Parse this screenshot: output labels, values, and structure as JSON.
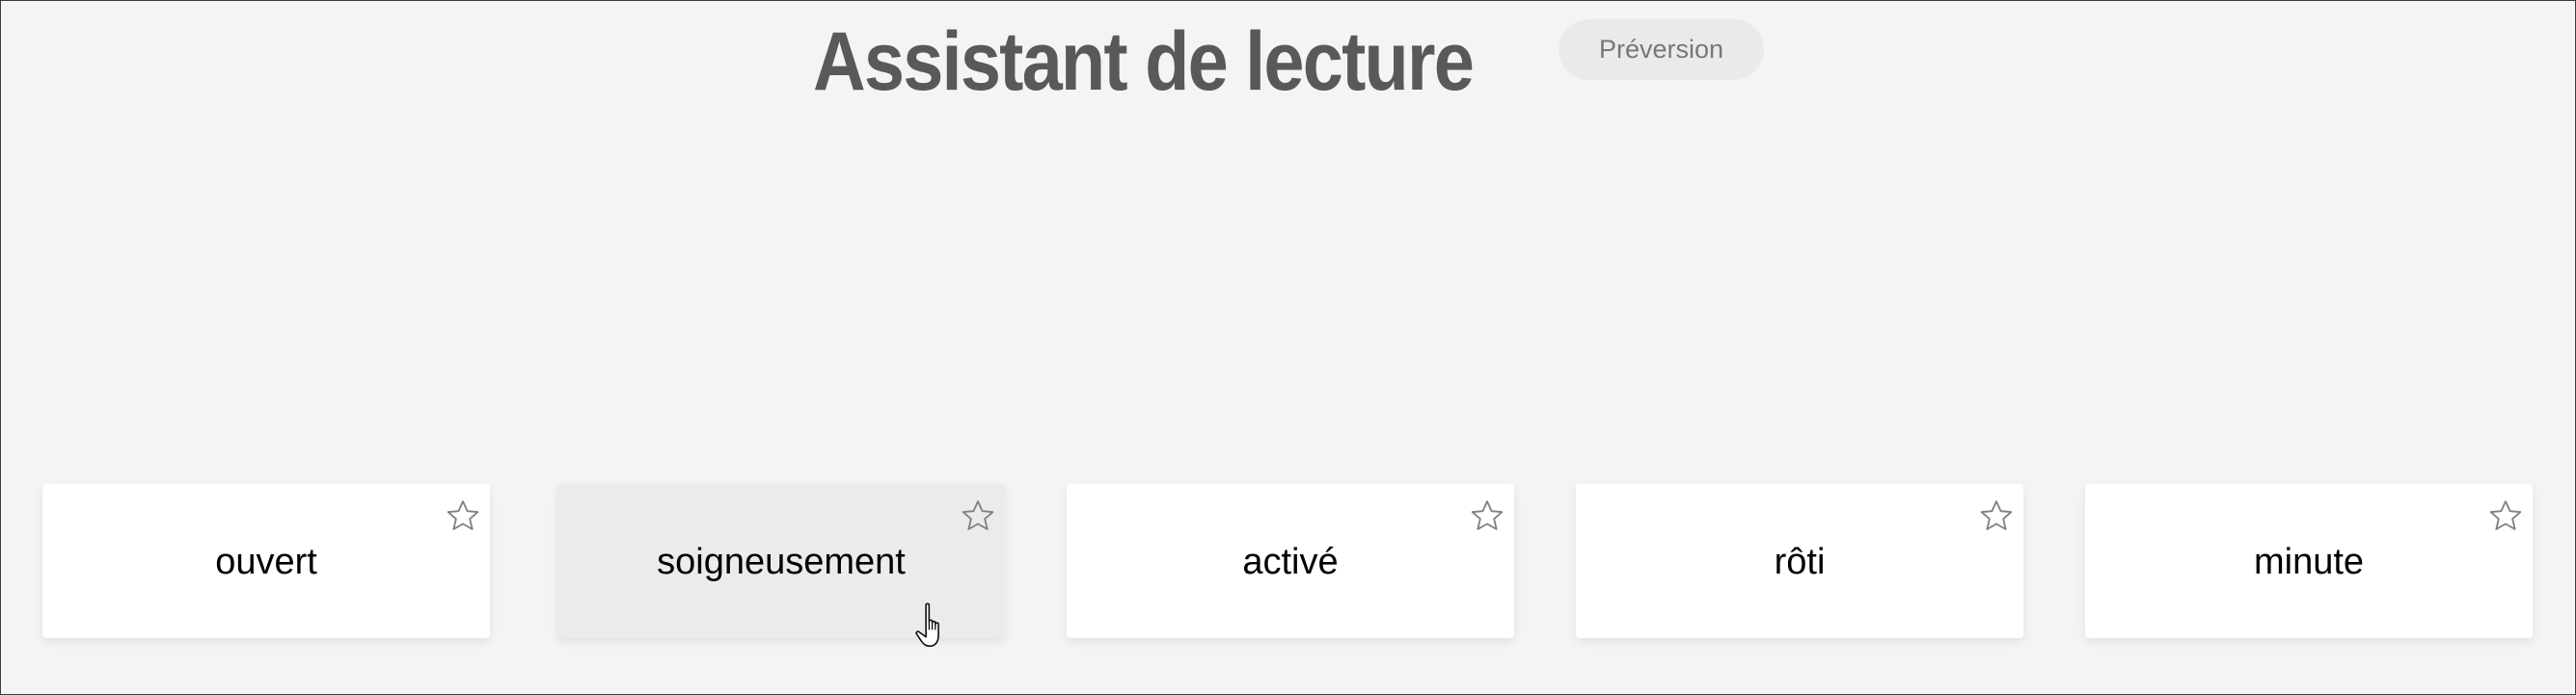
{
  "header": {
    "title": "Assistant de lecture",
    "badge": "Préversion"
  },
  "cards": [
    {
      "word": "ouvert",
      "favorited": false,
      "hovered": false
    },
    {
      "word": "soigneusement",
      "favorited": false,
      "hovered": true
    },
    {
      "word": "activé",
      "favorited": false,
      "hovered": false
    },
    {
      "word": "rôti",
      "favorited": false,
      "hovered": false
    },
    {
      "word": "minute",
      "favorited": false,
      "hovered": false
    }
  ],
  "icons": {
    "favorite": "star-outline-icon",
    "pointer": "hand-cursor-icon"
  },
  "colors": {
    "background": "#f4f4f4",
    "card": "#ffffff",
    "card_hover": "#edebe9",
    "title": "#595959",
    "badge_bg": "#ebeae8",
    "badge_text": "#777777"
  }
}
